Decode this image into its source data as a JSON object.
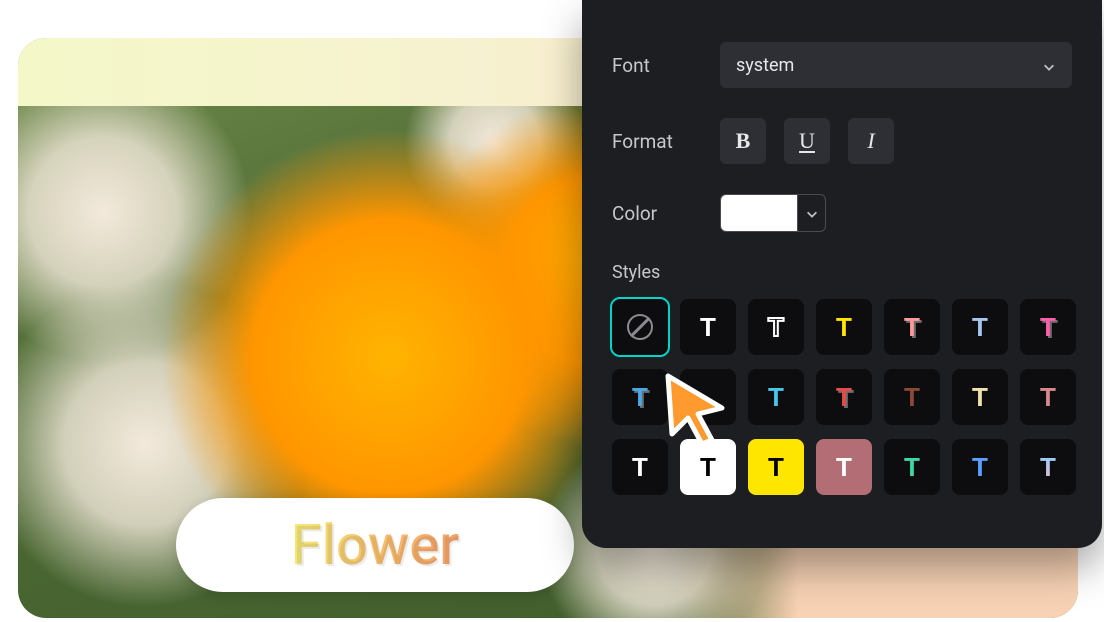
{
  "canvas": {
    "text_label": "Flower"
  },
  "panel": {
    "font": {
      "label": "Font",
      "value": "system"
    },
    "format": {
      "label": "Format",
      "bold": "B",
      "underline": "U",
      "italic": "I"
    },
    "color": {
      "label": "Color",
      "value": "#ffffff"
    },
    "styles": {
      "label": "Styles",
      "tiles": [
        {
          "id": "none",
          "selected": true,
          "glyph": "",
          "variant": "none"
        },
        {
          "id": "solid-white",
          "selected": false,
          "glyph": "T",
          "fg": "#ffffff"
        },
        {
          "id": "outline-wh",
          "selected": false,
          "glyph": "T",
          "variant": "outline"
        },
        {
          "id": "yellow",
          "selected": false,
          "glyph": "T",
          "fg": "#ffe600"
        },
        {
          "id": "pink-sh",
          "selected": false,
          "glyph": "T",
          "fg": "#ff9a9a",
          "variant": "shadow"
        },
        {
          "id": "ltblue",
          "selected": false,
          "glyph": "T",
          "fg": "#a9c6ef"
        },
        {
          "id": "magenta-sh",
          "selected": false,
          "glyph": "T",
          "fg": "#ff5fa8",
          "variant": "shadow"
        },
        {
          "id": "blue-out",
          "selected": false,
          "glyph": "T",
          "fg": "#4aa8e8",
          "variant": "shadow"
        },
        {
          "id": "hidden-cur",
          "selected": false,
          "glyph": "",
          "variant": "blank"
        },
        {
          "id": "cyan",
          "selected": false,
          "glyph": "T",
          "fg": "#48c7e8"
        },
        {
          "id": "red-out",
          "selected": false,
          "glyph": "T",
          "fg": "#e84a4a",
          "variant": "shadow"
        },
        {
          "id": "brown",
          "selected": false,
          "glyph": "T",
          "fg": "#8a4a3a"
        },
        {
          "id": "cream",
          "selected": false,
          "glyph": "T",
          "fg": "#f0e3b0"
        },
        {
          "id": "rose",
          "selected": false,
          "glyph": "T",
          "fg": "#d88a8a"
        },
        {
          "id": "bg-black",
          "selected": false,
          "glyph": "T",
          "fg": "#ffffff",
          "bg": "#0d0d0f"
        },
        {
          "id": "bg-white",
          "selected": false,
          "glyph": "T",
          "fg": "#000000",
          "bg": "white"
        },
        {
          "id": "bg-yellow",
          "selected": false,
          "glyph": "T",
          "fg": "#000000",
          "bg": "yellow"
        },
        {
          "id": "bg-mauve",
          "selected": false,
          "glyph": "T",
          "fg": "#ffffff",
          "bg": "mauve"
        },
        {
          "id": "mint",
          "selected": false,
          "glyph": "T",
          "fg": "#3ed9a0"
        },
        {
          "id": "blue2",
          "selected": false,
          "glyph": "T",
          "fg": "#5aa0ff"
        },
        {
          "id": "grad",
          "selected": false,
          "glyph": "T",
          "variant": "gradient"
        }
      ]
    }
  }
}
